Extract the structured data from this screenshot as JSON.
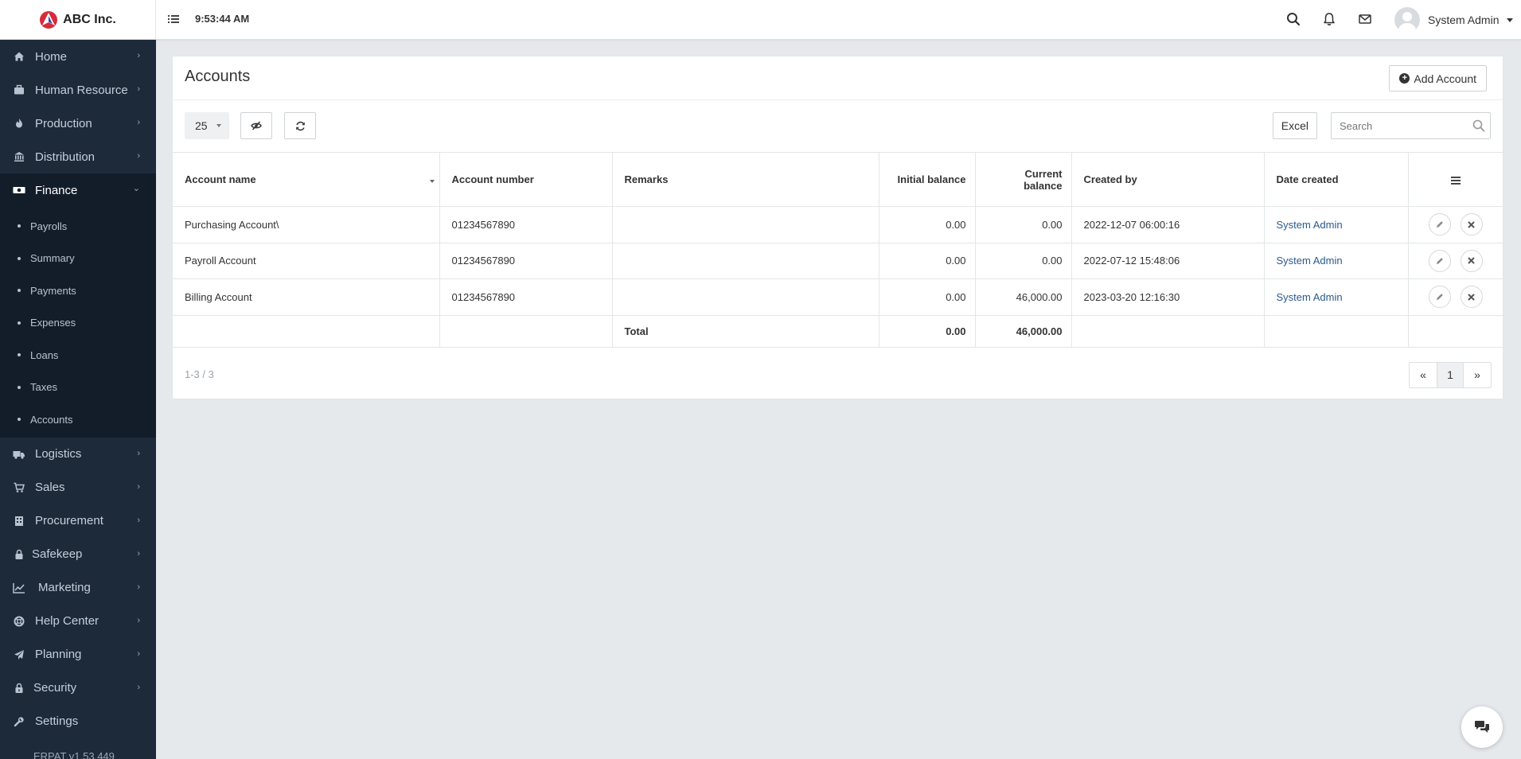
{
  "app": {
    "brand_name": "ABC Inc.",
    "clock": "9:53:44 AM",
    "version": "ERPAT v1.53.449"
  },
  "user": {
    "name": "System Admin"
  },
  "sidebar": {
    "items": [
      {
        "label": "Home",
        "icon": "home-icon"
      },
      {
        "label": "Human Resource",
        "icon": "briefcase-icon"
      },
      {
        "label": "Production",
        "icon": "fire-icon"
      },
      {
        "label": "Distribution",
        "icon": "bank-icon"
      },
      {
        "label": "Finance",
        "icon": "money-icon"
      },
      {
        "label": "Logistics",
        "icon": "truck-icon"
      },
      {
        "label": "Sales",
        "icon": "cart-icon"
      },
      {
        "label": "Procurement",
        "icon": "building-icon"
      },
      {
        "label": "Safekeep",
        "icon": "lock-icon"
      },
      {
        "label": "Marketing",
        "icon": "chart-line-icon"
      },
      {
        "label": "Help Center",
        "icon": "lifebuoy-icon"
      },
      {
        "label": "Planning",
        "icon": "paper-plane-icon"
      },
      {
        "label": "Security",
        "icon": "padlock-icon"
      },
      {
        "label": "Settings",
        "icon": "wrench-icon"
      }
    ],
    "finance_sub": [
      "Payrolls",
      "Summary",
      "Payments",
      "Expenses",
      "Loans",
      "Taxes",
      "Accounts"
    ]
  },
  "page": {
    "title": "Accounts",
    "add_label": "Add Account",
    "page_size": "25",
    "excel_label": "Excel",
    "search_placeholder": "Search",
    "range_info": "1-3 / 3",
    "current_page": "1",
    "prev_symbol": "«",
    "next_symbol": "»"
  },
  "table": {
    "headers": {
      "account_name": "Account name",
      "account_number": "Account number",
      "remarks": "Remarks",
      "initial_balance": "Initial balance",
      "current_balance_1": "Current",
      "current_balance_2": "balance",
      "created_by": "Created by",
      "date_created": "Date created"
    },
    "rows": [
      {
        "account_name": "Purchasing Account\\",
        "account_number": "01234567890",
        "remarks": "",
        "initial_balance": "0.00",
        "current_balance": "0.00",
        "created_by": "2022-12-07 06:00:16",
        "date_created": "System Admin"
      },
      {
        "account_name": "Payroll Account",
        "account_number": "01234567890",
        "remarks": "",
        "initial_balance": "0.00",
        "current_balance": "0.00",
        "created_by": "2022-07-12 15:48:06",
        "date_created": "System Admin"
      },
      {
        "account_name": "Billing Account",
        "account_number": "01234567890",
        "remarks": "",
        "initial_balance": "0.00",
        "current_balance": "46,000.00",
        "created_by": "2023-03-20 12:16:30",
        "date_created": "System Admin"
      }
    ],
    "totals": {
      "label": "Total",
      "initial_balance": "0.00",
      "current_balance": "46,000.00"
    }
  },
  "colors": {
    "sidebar_bg": "#1d2a3a",
    "sidebar_active_bg": "#131d2a",
    "link": "#2a5a8c",
    "page_bg": "#e5e9ec"
  }
}
